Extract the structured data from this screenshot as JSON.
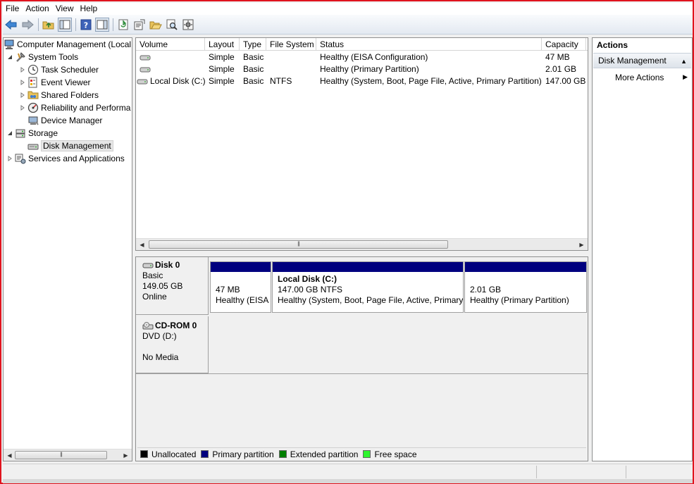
{
  "menu": [
    "File",
    "Action",
    "View",
    "Help"
  ],
  "toolbar": {
    "buttons": [
      "back-icon",
      "forward-icon",
      "up-folder-icon",
      "show-hide-tree-icon",
      "help-icon",
      "show-hide-action-pane-icon",
      "refresh-icon",
      "properties-icon",
      "open-folder-icon",
      "search-icon",
      "settings-icon"
    ]
  },
  "tree": {
    "root": "Computer Management (Local",
    "system_tools": "System Tools",
    "task_scheduler": "Task Scheduler",
    "event_viewer": "Event Viewer",
    "shared_folders": "Shared Folders",
    "reliability": "Reliability and Performa",
    "device_manager": "Device Manager",
    "storage": "Storage",
    "disk_management": "Disk Management",
    "services": "Services and Applications"
  },
  "volumes": {
    "columns": [
      "Volume",
      "Layout",
      "Type",
      "File System",
      "Status",
      "Capacity"
    ],
    "rows": [
      {
        "volume": "",
        "layout": "Simple",
        "type": "Basic",
        "fs": "",
        "status": "Healthy (EISA Configuration)",
        "capacity": "47 MB"
      },
      {
        "volume": "",
        "layout": "Simple",
        "type": "Basic",
        "fs": "",
        "status": "Healthy (Primary Partition)",
        "capacity": "2.01 GB"
      },
      {
        "volume": "Local Disk (C:)",
        "layout": "Simple",
        "type": "Basic",
        "fs": "NTFS",
        "status": "Healthy (System, Boot, Page File, Active, Primary Partition)",
        "capacity": "147.00 GB"
      }
    ]
  },
  "disks": {
    "disk0": {
      "name": "Disk 0",
      "type": "Basic",
      "size": "149.05 GB",
      "state": "Online",
      "partitions": [
        {
          "title": "",
          "size": "47 MB",
          "status": "Healthy (EISA"
        },
        {
          "title": "Local Disk  (C:)",
          "size": "147.00 GB NTFS",
          "status": "Healthy (System, Boot, Page File, Active, Primary"
        },
        {
          "title": "",
          "size": "2.01 GB",
          "status": "Healthy (Primary Partition)"
        }
      ]
    },
    "cdrom0": {
      "name": "CD-ROM 0",
      "type": "DVD (D:)",
      "media": "No Media"
    }
  },
  "legend": [
    {
      "label": "Unallocated",
      "color": "#000000"
    },
    {
      "label": "Primary partition",
      "color": "#00007f"
    },
    {
      "label": "Extended partition",
      "color": "#007f00"
    },
    {
      "label": "Free space",
      "color": "#2ef52e"
    }
  ],
  "actions": {
    "title": "Actions",
    "section": "Disk Management",
    "more": "More Actions"
  },
  "colors": {
    "frame_border": "#e0141e",
    "primary_partition": "#00007f"
  }
}
